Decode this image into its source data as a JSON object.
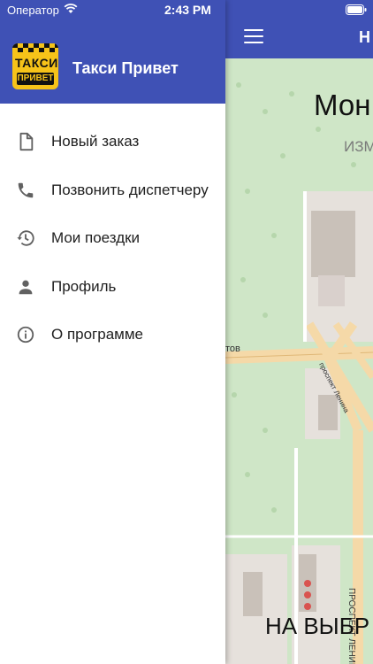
{
  "status_bar": {
    "carrier": "Оператор",
    "time": "2:43 PM"
  },
  "app_bar": {
    "title": "Н"
  },
  "drawer": {
    "logo": {
      "line1": "ТАКСИ",
      "line2": "ПРИВЕТ"
    },
    "app_name": "Такси Привет",
    "items": [
      {
        "label": "Новый заказ",
        "icon": "document-icon"
      },
      {
        "label": "Позвонить диспетчеру",
        "icon": "phone-icon"
      },
      {
        "label": "Мои поездки",
        "icon": "history-icon"
      },
      {
        "label": "Профиль",
        "icon": "person-icon"
      },
      {
        "label": "О программе",
        "icon": "info-icon"
      }
    ]
  },
  "map": {
    "top_label": "Мон",
    "sub_label": "ИЗМ",
    "bottom_label": "НА ВЫБР",
    "streets": [
      "тов",
      "ПРОСПЕКТ ЛЕНИНА",
      "проспект Ленина"
    ]
  },
  "colors": {
    "primary": "#3f51b5",
    "map_green": "#cfe6c7",
    "road": "#f5d9a8",
    "logo_yellow": "#f6c319"
  }
}
